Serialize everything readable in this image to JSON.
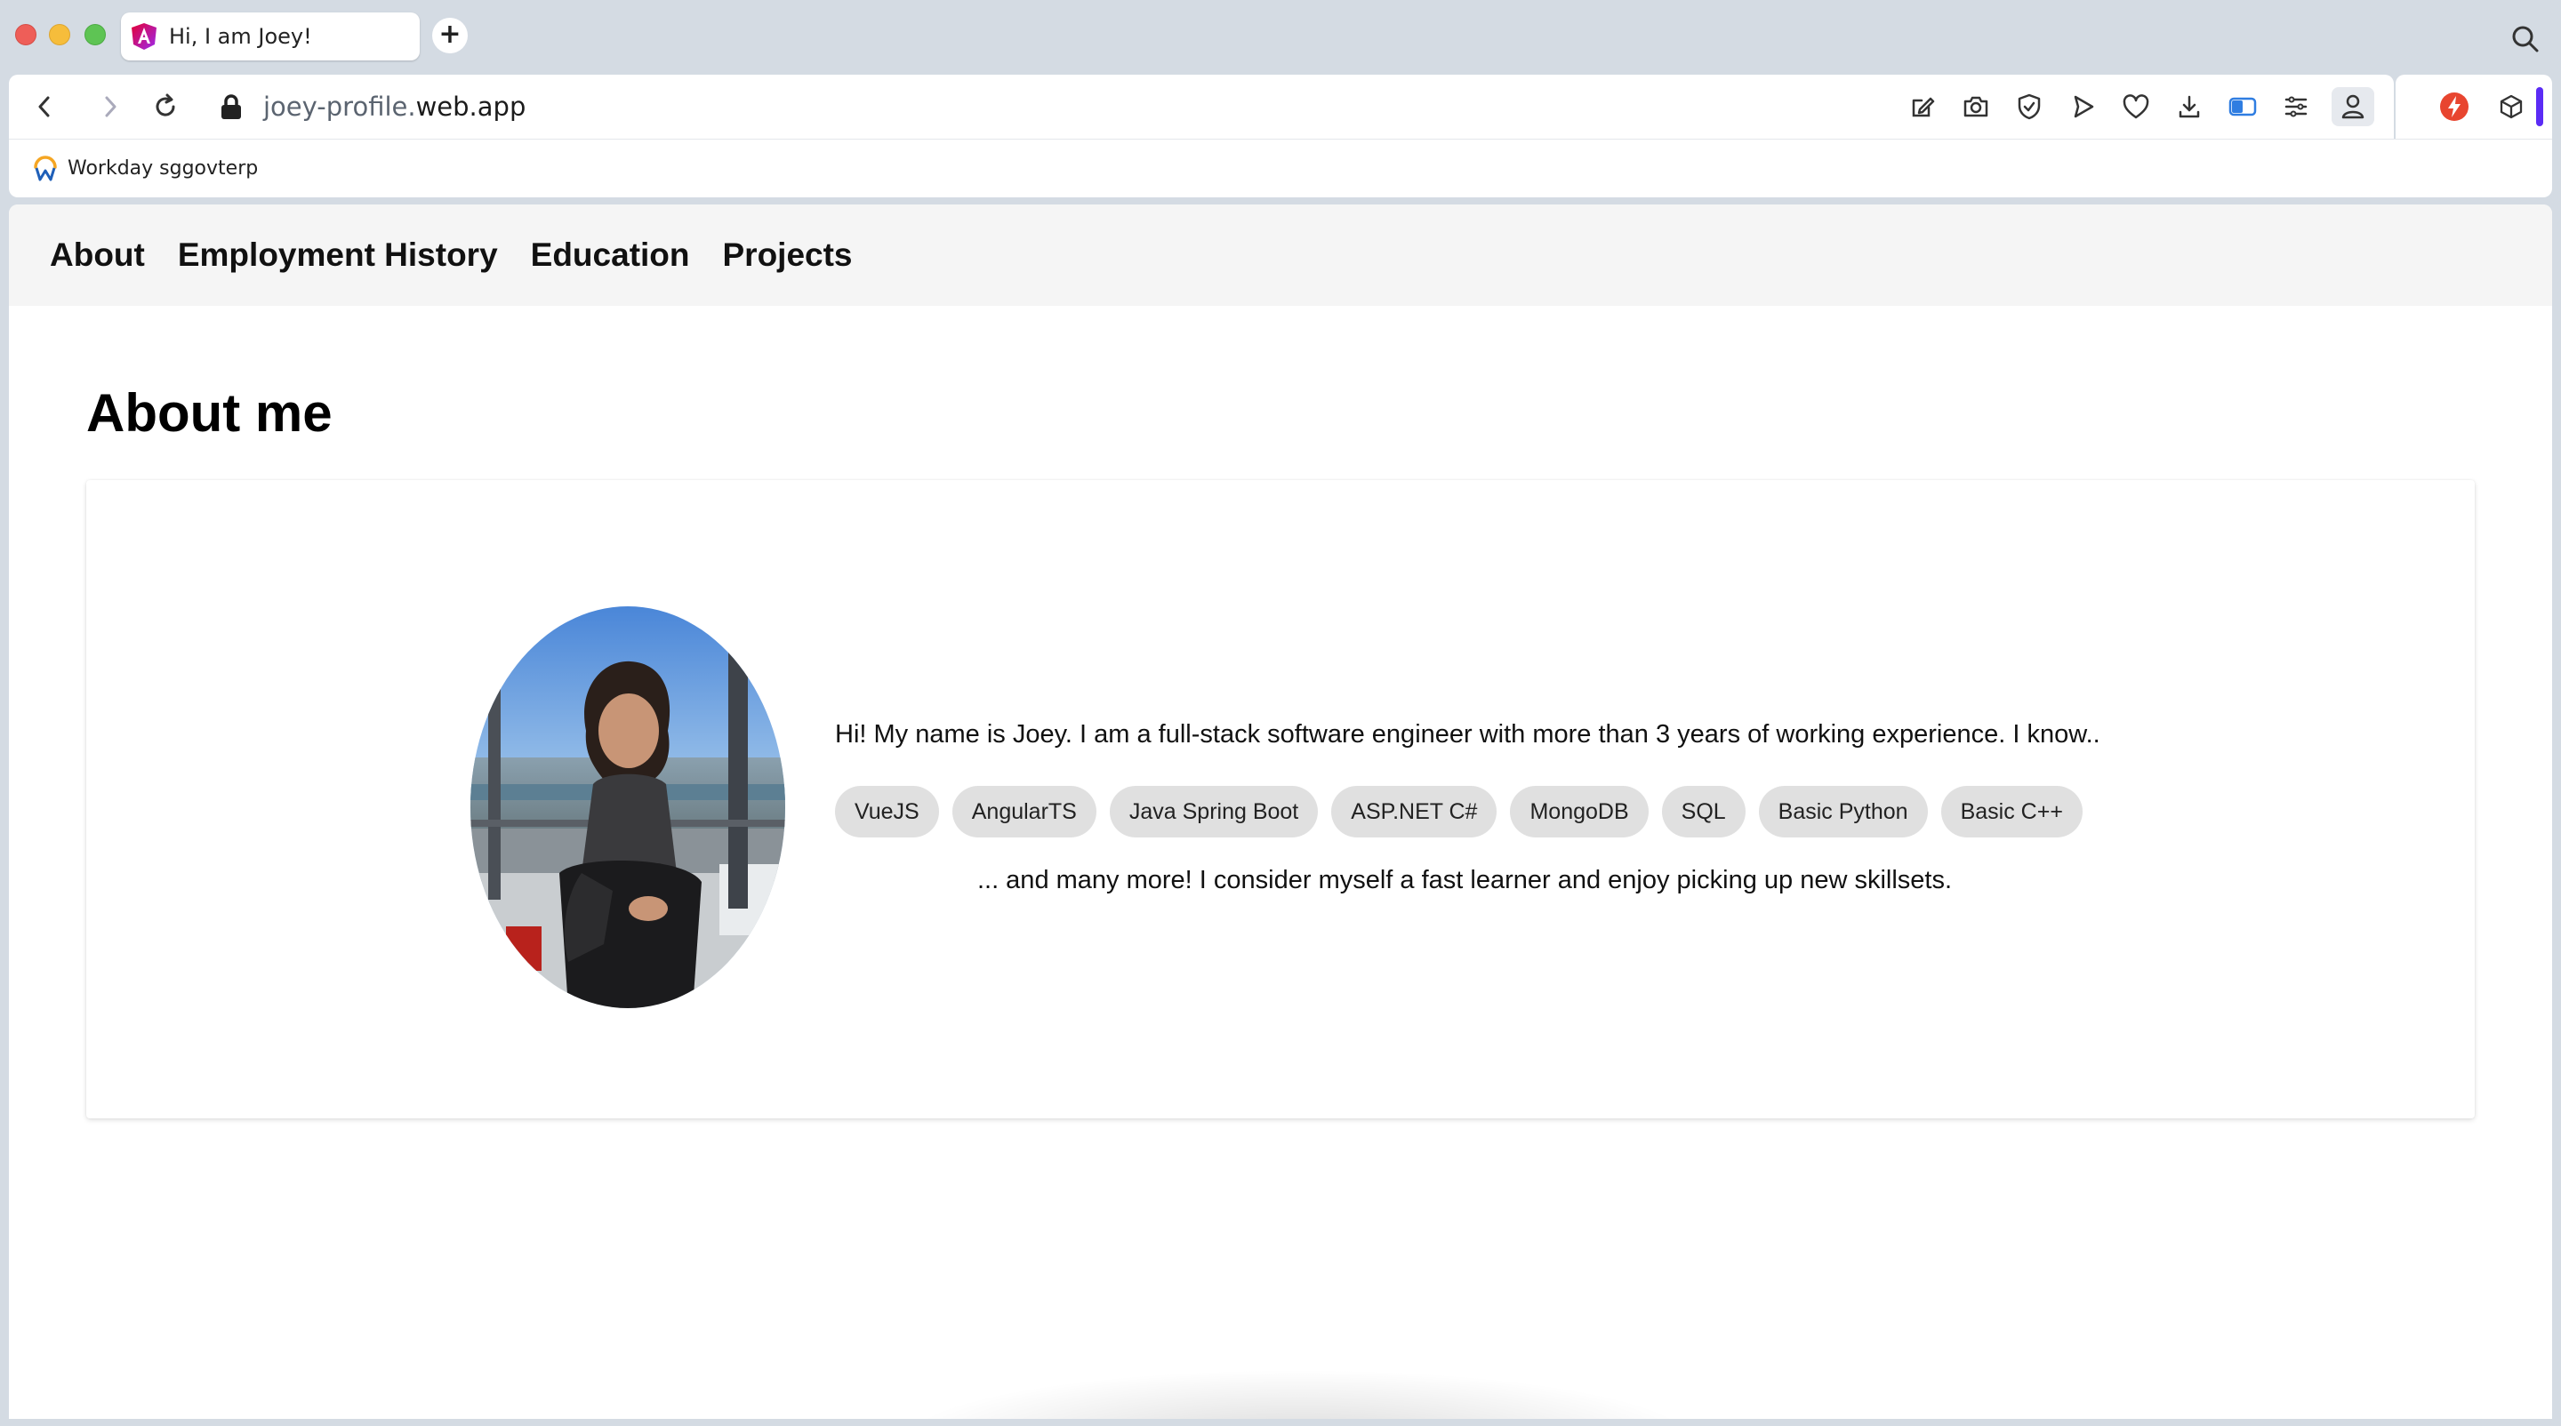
{
  "browser": {
    "tab": {
      "title": "Hi, I am Joey!",
      "favicon": "angular-icon"
    },
    "new_tab_label": "+",
    "address": {
      "subdomain": "joey-profile.",
      "domain": "web.app"
    },
    "bookmarks": [
      {
        "label": "Workday sggovterp",
        "icon": "workday-icon"
      }
    ],
    "toolbar_icons": [
      "edit-icon",
      "camera-icon",
      "shield-icon",
      "play-icon",
      "heart-icon",
      "download-icon",
      "toggle-icon",
      "menu-icon",
      "profile-icon"
    ],
    "extension_icons": [
      "extension-red-icon",
      "cube-icon"
    ]
  },
  "site": {
    "nav": [
      "About",
      "Employment History",
      "Education",
      "Projects"
    ],
    "about": {
      "heading": "About me",
      "intro": "Hi! My name is Joey. I am a full-stack software engineer with more than 3 years of working experience. I know..",
      "skills": [
        "VueJS",
        "AngularTS",
        "Java Spring Boot",
        "ASP.NET C#",
        "MongoDB",
        "SQL",
        "Basic Python",
        "Basic C++"
      ],
      "outro": "... and many more! I consider myself a fast learner and enjoy picking up new skillsets."
    }
  },
  "colors": {
    "chrome_bg": "#d4dbe3",
    "nav_bg": "#f5f5f5",
    "chip_bg": "#e0e0e0",
    "accent_purple": "#5b2cf5"
  }
}
